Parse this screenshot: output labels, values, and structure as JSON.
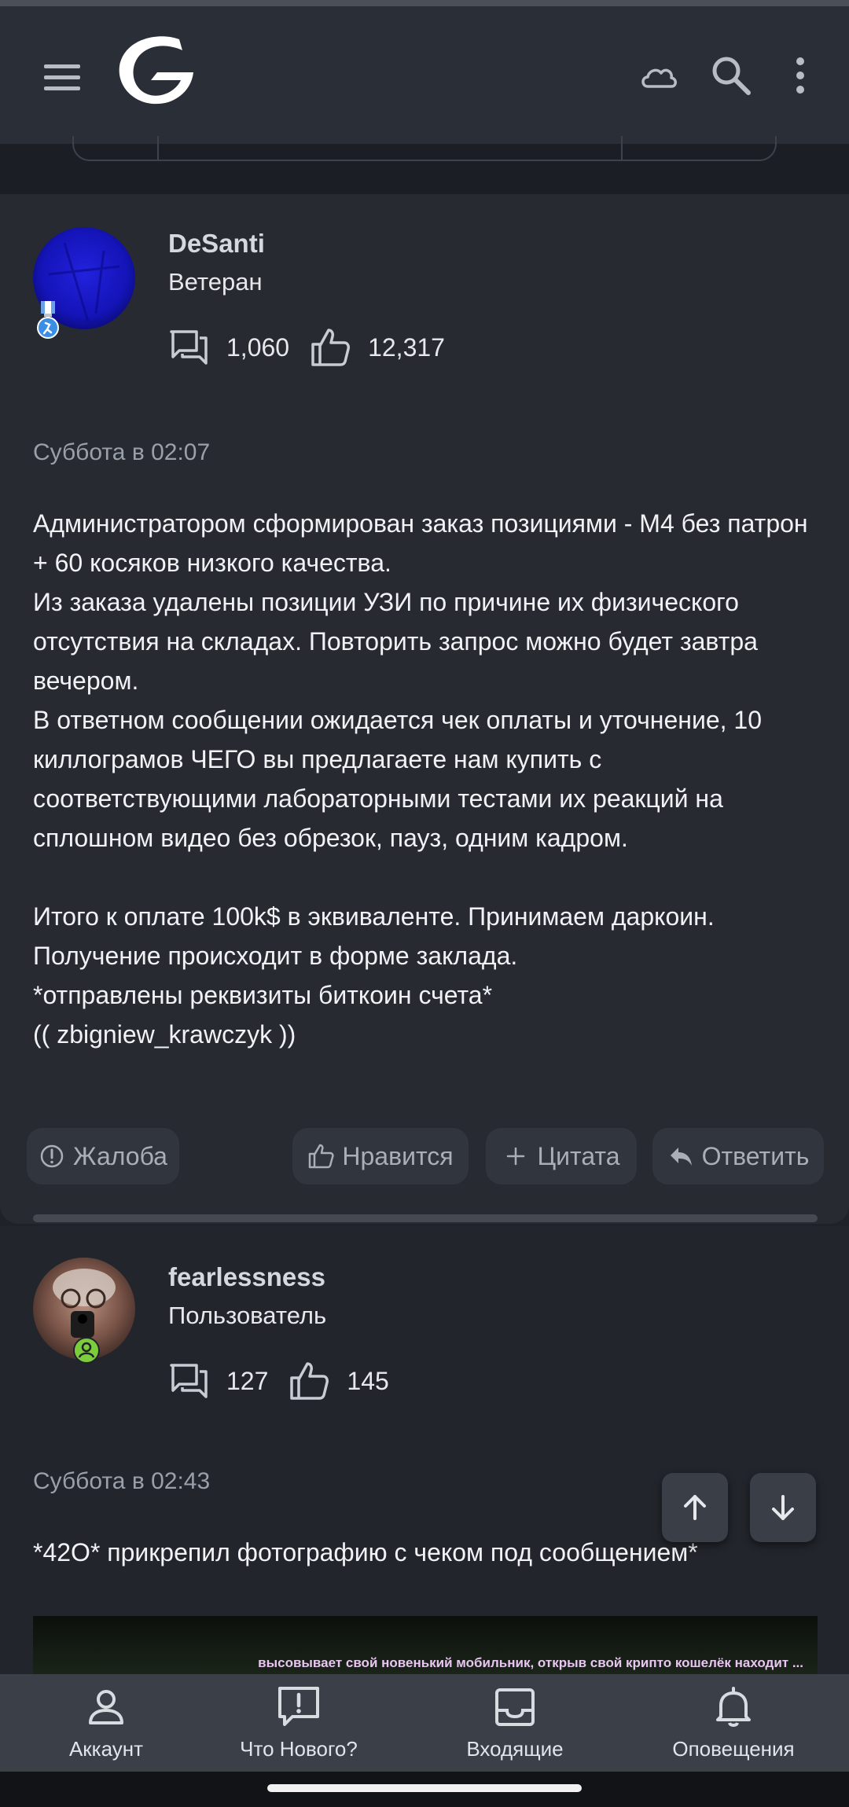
{
  "app": {
    "icons": {
      "menu": "hamburger-menu-icon",
      "logo": "site-logo",
      "cloud": "cloud-icon",
      "search": "search-icon",
      "more": "more-vertical-icon"
    }
  },
  "posts": [
    {
      "username": "DeSanti",
      "role": "Ветеран",
      "messages": "1,060",
      "likes": "12,317",
      "date": "Суббота в 02:07",
      "paragraphs": [
        "Администратором сформирован заказ позициями - М4 без патрон + 60 косяков низкого качества.",
        "Из заказа удалены позиции УЗИ по причине их физического отсутствия на складах. Повторить запрос можно будет завтра вечером.",
        "В ответном сообщении ожидается чек оплаты и уточнение, 10 киллограмов ЧЕГО вы предлагаете нам купить с соответствующими лабораторными тестами их реакций на сплошном видео без обрезок, пауз, одним кадром.",
        "",
        "Итого к оплате 100k$ в эквиваленте. Принимаем даркоин.",
        "Получение происходит в форме заклада.",
        "*отправлены реквизиты биткоин счета*",
        "(( zbigniew_krawczyk ))"
      ],
      "actions": {
        "report": "Жалоба",
        "like": "Нравится",
        "quote": "Цитата",
        "reply": "Ответить"
      },
      "accent": "#1a1acc"
    },
    {
      "username": "fearlessness",
      "role": "Пользователь",
      "messages": "127",
      "likes": "145",
      "date": "Суббота в 02:43",
      "text": "*42O* прикрепил фотографию с чеком под сообщением*",
      "image_caption": "высовывает свой новенький мобильник, открыв свой крипто кошелёк находит ..."
    }
  ],
  "scroll": {
    "up": "arrow-up-icon",
    "down": "arrow-down-icon"
  },
  "bottom_nav": [
    {
      "label": "Аккаунт",
      "icon": "account-icon"
    },
    {
      "label": "Что Нового?",
      "icon": "whats-new-icon"
    },
    {
      "label": "Входящие",
      "icon": "inbox-icon"
    },
    {
      "label": "Оповещения",
      "icon": "bell-icon"
    }
  ],
  "colors": {
    "background": "#1f2229",
    "appbar": "#2a2e36",
    "nav": "#3a3f48",
    "badge_green": "#7ccd3c",
    "badge_blue": "#3a8ee6"
  }
}
